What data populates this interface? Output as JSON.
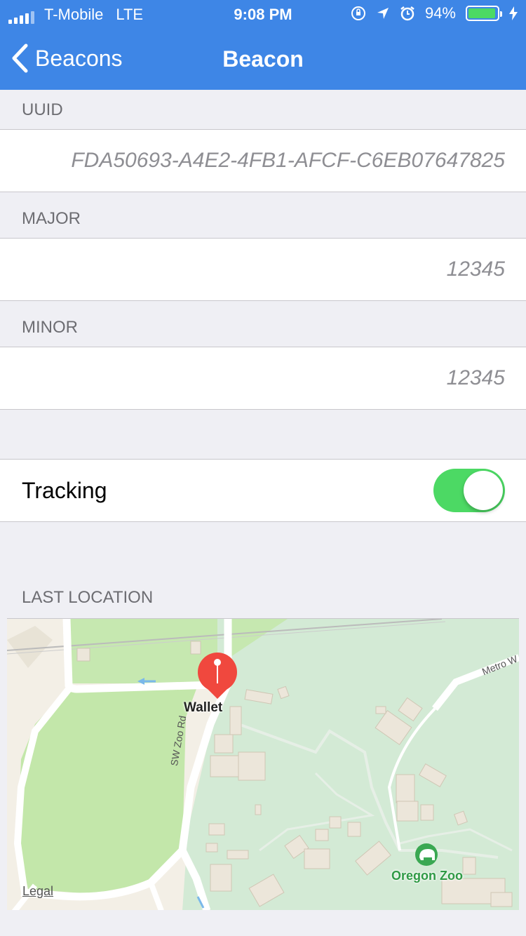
{
  "status_bar": {
    "carrier": "T-Mobile",
    "network": "LTE",
    "time": "9:08 PM",
    "battery_percent": "94%",
    "battery_level": 0.94,
    "icons": [
      "orientation-lock-icon",
      "location-arrow-icon",
      "alarm-icon",
      "charging-bolt-icon"
    ]
  },
  "nav": {
    "back_label": "Beacons",
    "title": "Beacon"
  },
  "uuid": {
    "header": "UUID",
    "value": "FDA50693-A4E2-4FB1-AFCF-C6EB07647825"
  },
  "major": {
    "header": "MAJOR",
    "value": "12345"
  },
  "minor": {
    "header": "MINOR",
    "value": "12345"
  },
  "tracking": {
    "label": "Tracking",
    "enabled": true
  },
  "last_location": {
    "header": "LAST LOCATION",
    "map": {
      "pin_label": "Wallet",
      "poi_label": "Oregon Zoo",
      "road_labels": [
        "Metro W",
        "SW Zoo Rd"
      ],
      "legal_link": "Legal"
    }
  },
  "colors": {
    "nav_bar": "#3e86e6",
    "toggle_on": "#4cd964",
    "pin": "#f0483e",
    "background": "#efeff4"
  }
}
